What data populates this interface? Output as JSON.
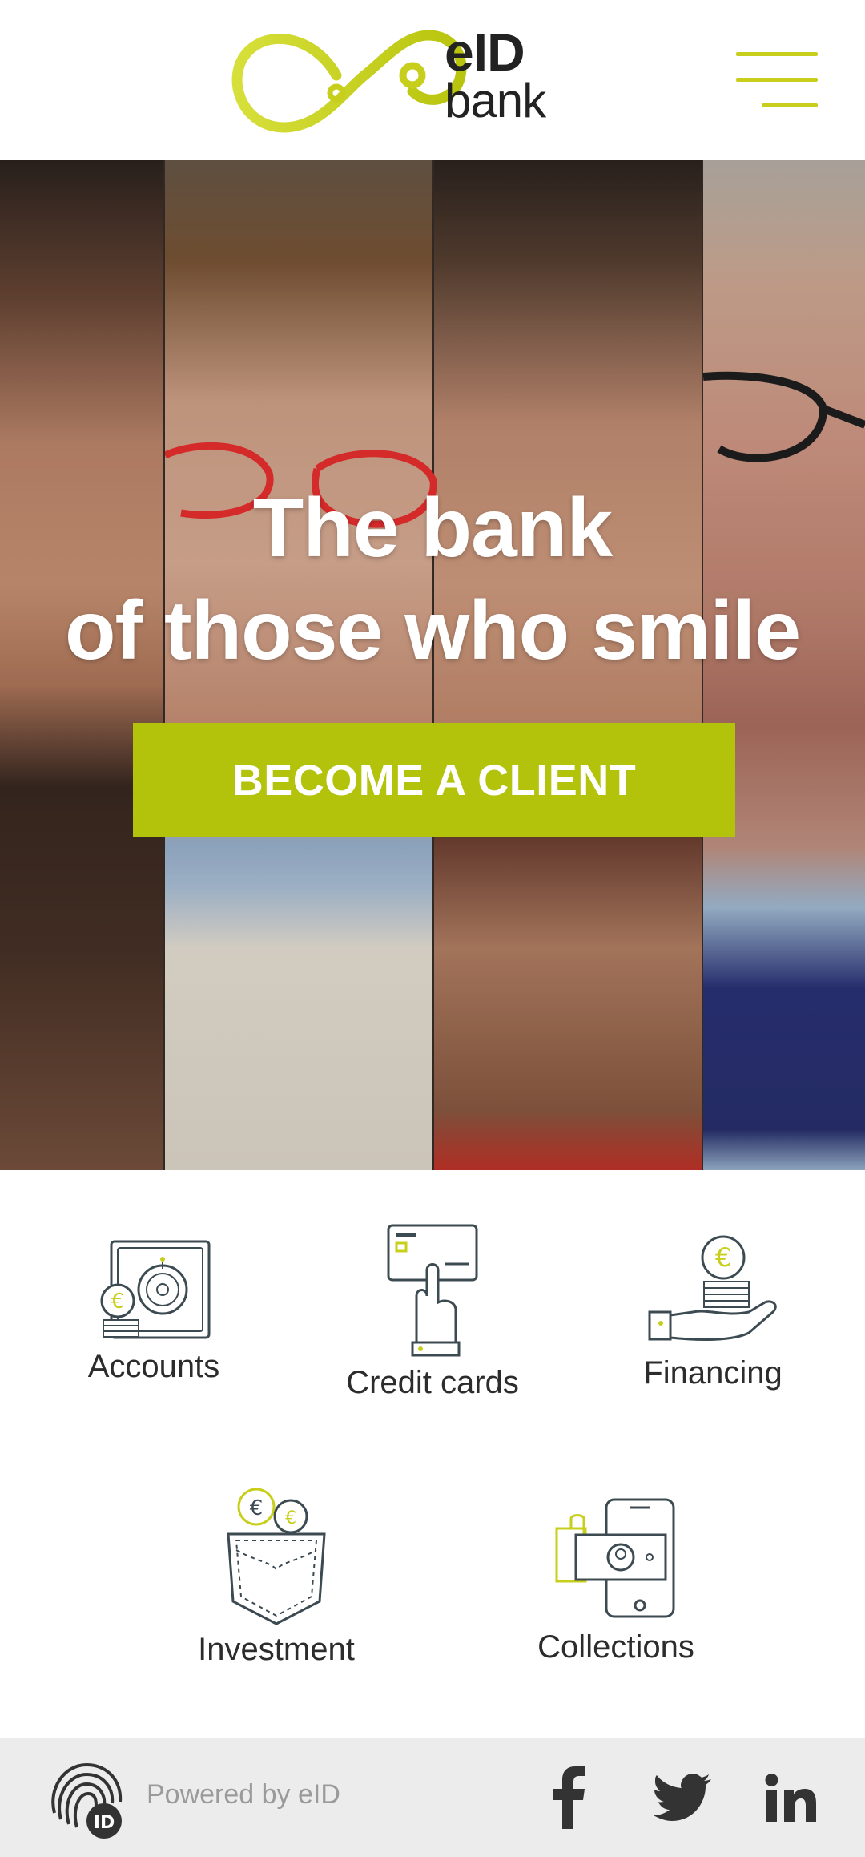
{
  "brand": {
    "name_line1": "eID",
    "name_line2": "bank",
    "accent": "#c7cf1c",
    "cta_color": "#b3c20a"
  },
  "hero": {
    "title_line1": "The bank",
    "title_line2": "of those who smile",
    "cta_label": "BECOME A CLIENT"
  },
  "services": [
    {
      "label": "Accounts",
      "icon": "safe-icon"
    },
    {
      "label": "Credit cards",
      "icon": "card-hand-icon"
    },
    {
      "label": "Financing",
      "icon": "hand-coins-icon"
    },
    {
      "label": "Investment",
      "icon": "pocket-coins-icon"
    },
    {
      "label": "Collections",
      "icon": "phone-money-icon"
    }
  ],
  "footer": {
    "powered_by": "Powered by eID",
    "social": [
      "facebook-icon",
      "twitter-icon",
      "linkedin-icon"
    ]
  }
}
